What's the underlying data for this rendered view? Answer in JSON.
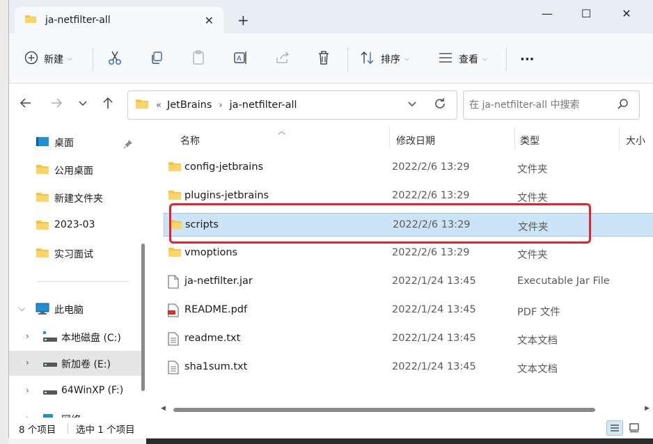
{
  "tab": {
    "title": "ja-netfilter-all",
    "close": "✕",
    "new": "+"
  },
  "window_controls": {
    "minimize": "—",
    "maximize": "☐",
    "close": "✕"
  },
  "toolbar": {
    "new_label": "新建",
    "sort_label": "排序",
    "view_label": "查看",
    "more_label": "···"
  },
  "breadcrumb": {
    "overflow": "«",
    "items": [
      "JetBrains",
      "ja-netfilter-all"
    ],
    "sep": "›"
  },
  "search": {
    "placeholder": "在 ja-netfilter-all 中搜索"
  },
  "sidebar": {
    "items": [
      {
        "label": "桌面",
        "icon": "desktop-icon"
      },
      {
        "label": "公用桌面",
        "icon": "folder-icon"
      },
      {
        "label": "新建文件夹",
        "icon": "folder-icon"
      },
      {
        "label": "2023-03",
        "icon": "folder-icon"
      },
      {
        "label": "实习面试",
        "icon": "folder-icon"
      },
      {
        "label": "此电脑",
        "icon": "computer-icon"
      },
      {
        "label": "本地磁盘 (C:)",
        "icon": "drive-icon"
      },
      {
        "label": "新加卷 (E:)",
        "icon": "drive-icon"
      },
      {
        "label": "64WinXP  (F:)",
        "icon": "drive-icon"
      },
      {
        "label": "网络",
        "icon": "network-icon"
      }
    ]
  },
  "columns": {
    "name": "名称",
    "date": "修改日期",
    "type": "类型",
    "size": "大小"
  },
  "files": [
    {
      "name": "config-jetbrains",
      "date": "2022/2/6 13:29",
      "type": "文件夹",
      "icon": "folder-icon"
    },
    {
      "name": "plugins-jetbrains",
      "date": "2022/2/6 13:29",
      "type": "文件夹",
      "icon": "folder-icon"
    },
    {
      "name": "scripts",
      "date": "2022/2/6 13:29",
      "type": "文件夹",
      "icon": "folder-icon"
    },
    {
      "name": "vmoptions",
      "date": "2022/2/6 13:29",
      "type": "文件夹",
      "icon": "folder-icon"
    },
    {
      "name": "ja-netfilter.jar",
      "date": "2022/1/24 13:45",
      "type": "Executable Jar File",
      "icon": "file-icon"
    },
    {
      "name": "README.pdf",
      "date": "2022/1/24 13:45",
      "type": "PDF 文件",
      "icon": "pdf-icon"
    },
    {
      "name": "readme.txt",
      "date": "2022/1/24 13:45",
      "type": "文本文档",
      "icon": "text-file-icon"
    },
    {
      "name": "sha1sum.txt",
      "date": "2022/1/24 13:45",
      "type": "文本文档",
      "icon": "text-file-icon"
    }
  ],
  "status": {
    "count": "8 个项目",
    "selected": "选中 1 个项目"
  },
  "colors": {
    "selection": "#cce4f7",
    "highlight": "#e8202a",
    "folder": "#f4c542"
  }
}
